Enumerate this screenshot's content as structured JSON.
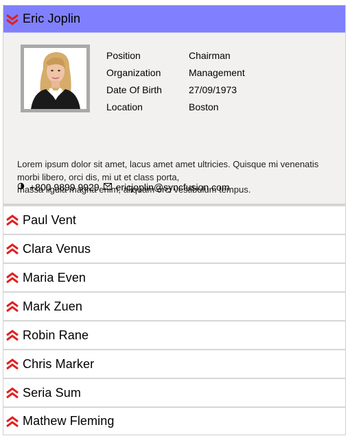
{
  "accordion": {
    "expanded": {
      "name": "Eric Joplin",
      "details": [
        {
          "label": "Position",
          "value": "Chairman"
        },
        {
          "label": "Organization",
          "value": "Management"
        },
        {
          "label": "Date Of Birth",
          "value": "27/09/1973"
        },
        {
          "label": "Location",
          "value": "Boston"
        }
      ],
      "description_lines": [
        "Lorem ipsum dolor sit amet, lacus amet amet ultricies. Quisque mi venenatis",
        "morbi libero, orci dis, mi ut et class porta,",
        "massa ligula magna enim, aliquam orci vestibulum tempus."
      ],
      "phone": "+800 9899 9929",
      "email": "ericjoplin@syncfusion.com"
    },
    "collapsed": [
      {
        "name": "Paul Vent"
      },
      {
        "name": "Clara Venus"
      },
      {
        "name": "Maria Even"
      },
      {
        "name": "Mark Zuen"
      },
      {
        "name": "Robin Rane"
      },
      {
        "name": "Chris Marker"
      },
      {
        "name": "Seria Sum"
      },
      {
        "name": "Mathew Fleming"
      }
    ]
  },
  "colors": {
    "expanded_header": "#8080ff",
    "chevron": "#e02020",
    "body_bg": "#f2f1f0"
  },
  "icons": {
    "expand": "double-chevron-down-icon",
    "collapse": "double-chevron-up-icon",
    "phone": "phone-icon",
    "mail": "mail-icon"
  }
}
